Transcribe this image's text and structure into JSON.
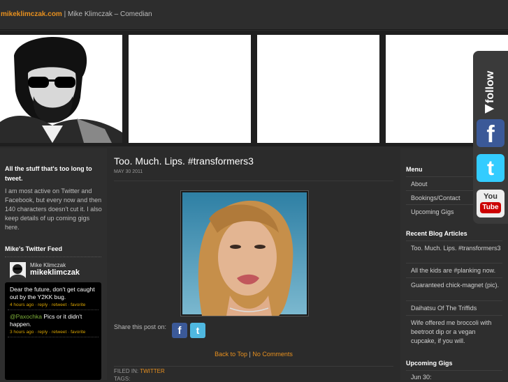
{
  "header": {
    "site": "mikeklimczak.com",
    "separator": " | ",
    "tagline": "Mike Klimczak – Comedian"
  },
  "follow": {
    "label": "follow me",
    "icons": [
      "facebook-icon",
      "twitter-icon",
      "youtube-icon"
    ],
    "youtube_text_top": "You",
    "youtube_text_bottom": "Tube"
  },
  "left": {
    "intro_title": "All the stuff that's too long to tweet.",
    "intro_text": "I am most active on Twitter and Facebook, but every now and then 140 characters doesn't cut it. I also keep details of up coming gigs here.",
    "feed_title": "Mike's Twitter Feed",
    "profile_name": "Mike Klimczak",
    "profile_handle": "mikeklimczak",
    "tweets": [
      {
        "text": "Dear the future, don't get caught out by the Y2KK bug.",
        "meta": "4 hours ago · reply · retweet · favorite"
      },
      {
        "mention": "@Paxochka",
        "text": " Pics or it didn't happen.",
        "meta": "3 hours ago · reply · retweet · favorite"
      }
    ]
  },
  "post": {
    "title": "Too. Much. Lips. #transformers3",
    "date": "MAY 30 2011",
    "share_label": "Share this post on:",
    "back_to_top": "Back to Top",
    "sep": " | ",
    "no_comments": "No Comments",
    "filed_label": "FILED IN: ",
    "filed_value": "TWITTER",
    "tags_label": "TAGS:"
  },
  "right": {
    "menu_title": "Menu",
    "menu": [
      "About",
      "Bookings/Contact",
      "Upcoming Gigs"
    ],
    "recent_title": "Recent Blog Articles",
    "recent": [
      "Too. Much. Lips. #transformers3",
      "All the kids are #planking now.",
      "Guaranteed chick-magnet (pic).",
      "Daihatsu Of The Triffids",
      "Wife offered me broccoli with beetroot dip or a vegan cupcake, if you will."
    ],
    "gigs_title": "Upcoming Gigs",
    "gigs_first": "Jun 30:"
  },
  "colors": {
    "accent": "#e8901e",
    "background": "#2b2b2b",
    "facebook": "#3b5998",
    "twitter": "#33ccff",
    "youtube": "#cc0000"
  }
}
